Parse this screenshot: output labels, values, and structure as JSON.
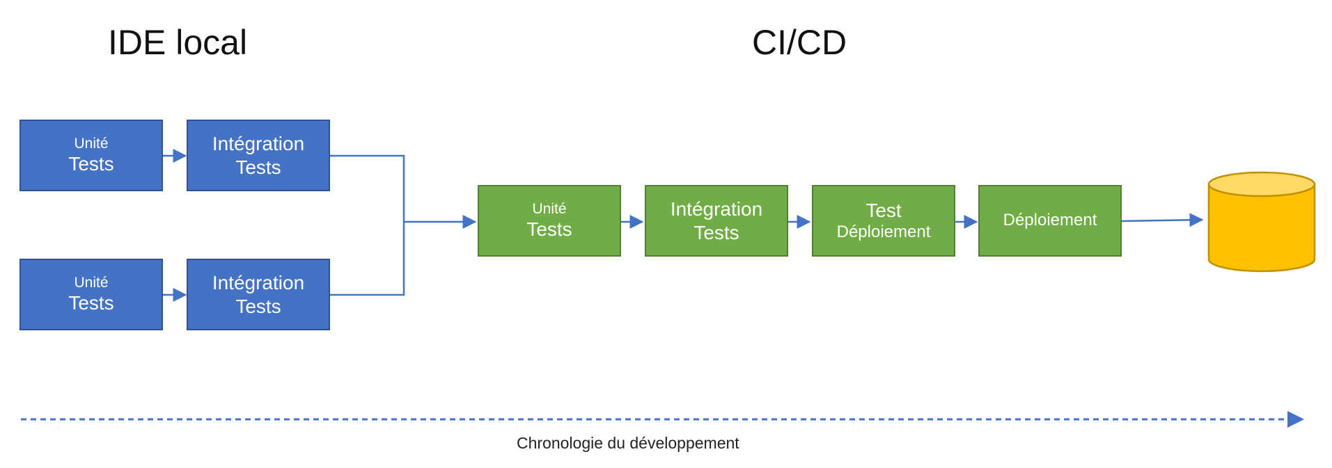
{
  "sections": {
    "local": "IDE local",
    "cicd": "CI/CD"
  },
  "local_rows": [
    {
      "unit": {
        "top": "Unité",
        "bottom": "Tests"
      },
      "integration": {
        "top": "Intégration",
        "bottom": "Tests"
      }
    },
    {
      "unit": {
        "top": "Unité",
        "bottom": "Tests"
      },
      "integration": {
        "top": "Intégration",
        "bottom": "Tests"
      }
    }
  ],
  "pipeline": [
    {
      "top": "Unité",
      "bottom": "Tests"
    },
    {
      "top": "Intégration",
      "bottom": "Tests"
    },
    {
      "top": "Test",
      "bottom": "Déploiement"
    },
    {
      "top": "Déploiement",
      "bottom": ""
    }
  ],
  "timeline": {
    "label": "Chronologie du développement"
  },
  "colors": {
    "local": "#4472c4",
    "cicd": "#70ad47",
    "database": "#ffc000",
    "arrow": "#4472c4"
  }
}
